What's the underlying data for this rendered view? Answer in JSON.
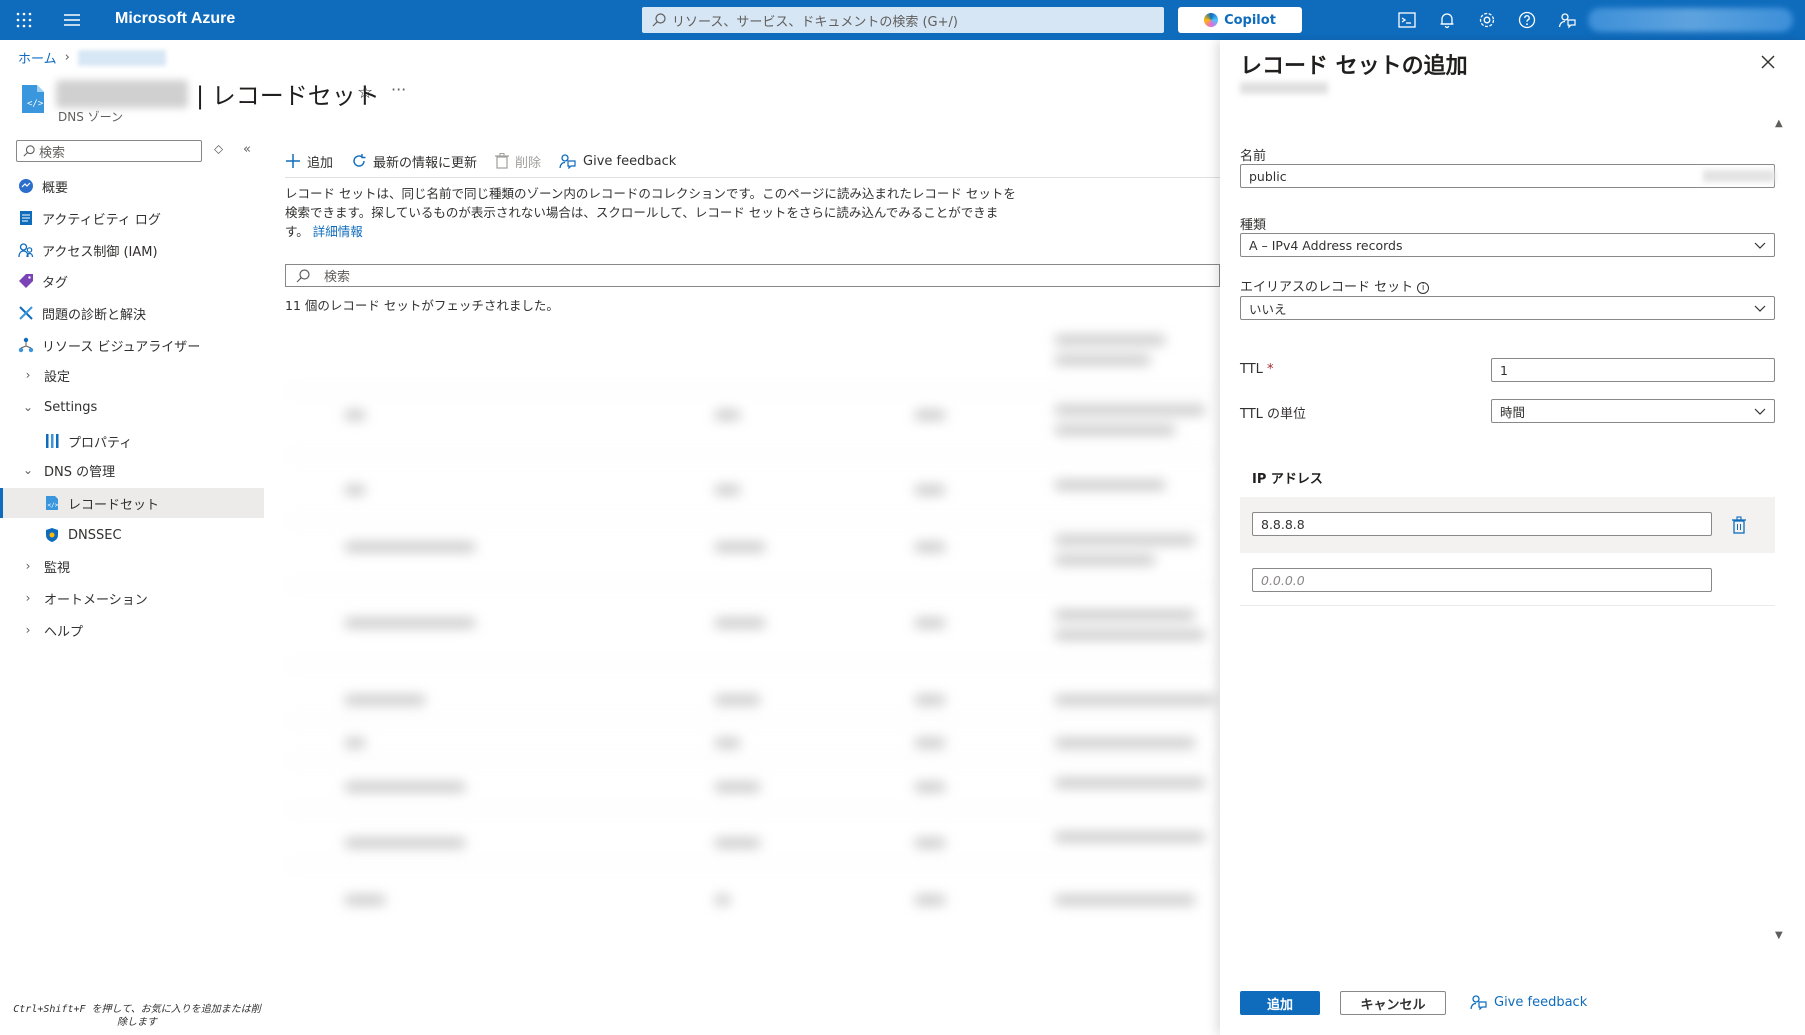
{
  "topbar": {
    "brand": "Microsoft Azure",
    "search_placeholder": "リソース、サービス、ドキュメントの検索 (G+/)",
    "copilot_label": "Copilot",
    "icons": [
      "cloud-shell-icon",
      "notifications-icon",
      "settings-icon",
      "help-icon",
      "feedback-icon"
    ],
    "accent_color": "#0f6cbd"
  },
  "breadcrumb": {
    "home": "ホーム"
  },
  "page": {
    "title": "| レコードセット",
    "subtitle": "DNS ゾーン"
  },
  "sidebar": {
    "search_placeholder": "検索",
    "items": [
      {
        "label": "概要",
        "icon": "overview-icon"
      },
      {
        "label": "アクティビティ ログ",
        "icon": "activity-log-icon"
      },
      {
        "label": "アクセス制御 (IAM)",
        "icon": "iam-icon"
      },
      {
        "label": "タグ",
        "icon": "tag-icon"
      },
      {
        "label": "問題の診断と解決",
        "icon": "diagnose-icon"
      },
      {
        "label": "リソース ビジュアライザー",
        "icon": "visualizer-icon"
      },
      {
        "label": "設定"
      },
      {
        "label": "Settings"
      },
      {
        "label": "プロパティ",
        "icon": "properties-icon"
      },
      {
        "label": "DNS の管理"
      },
      {
        "label": "レコードセット",
        "icon": "recordset-icon"
      },
      {
        "label": "DNSSEC",
        "icon": "dnssec-shield-icon"
      },
      {
        "label": "監視"
      },
      {
        "label": "オートメーション"
      },
      {
        "label": "ヘルプ"
      }
    ],
    "footer_hint": "Ctrl+Shift+F を押して、お気に入りを追加または削除します"
  },
  "toolbar": {
    "add": "追加",
    "refresh": "最新の情報に更新",
    "delete": "削除",
    "feedback": "Give feedback"
  },
  "content": {
    "description": "レコード セットは、同じ名前で同じ種類のゾーン内のレコードのコレクションです。このページに読み込まれたレコード セットを検索できます。探しているものが表示されない場合は、スクロールして、レコード セットをさらに読み込んでみることができます。",
    "learn_more": "詳細情報",
    "search_placeholder": "検索",
    "fetched_text": "11 個のレコード セットがフェッチされました。"
  },
  "panel": {
    "title": "レコード セットの追加",
    "name_label": "名前",
    "name_value": "public",
    "type_label": "種類",
    "type_value": "A – IPv4 Address records",
    "alias_label": "エイリアスのレコード セット",
    "alias_value": "いいえ",
    "ttl_label": "TTL",
    "ttl_required": "*",
    "ttl_value": "1",
    "ttl_unit_label": "TTL の単位",
    "ttl_unit_value": "時間",
    "ip_header": "IP アドレス",
    "ip_value": "8.8.8.8",
    "ip_placeholder": "0.0.0.0",
    "add_button": "追加",
    "cancel_button": "キャンセル",
    "feedback": "Give feedback"
  }
}
